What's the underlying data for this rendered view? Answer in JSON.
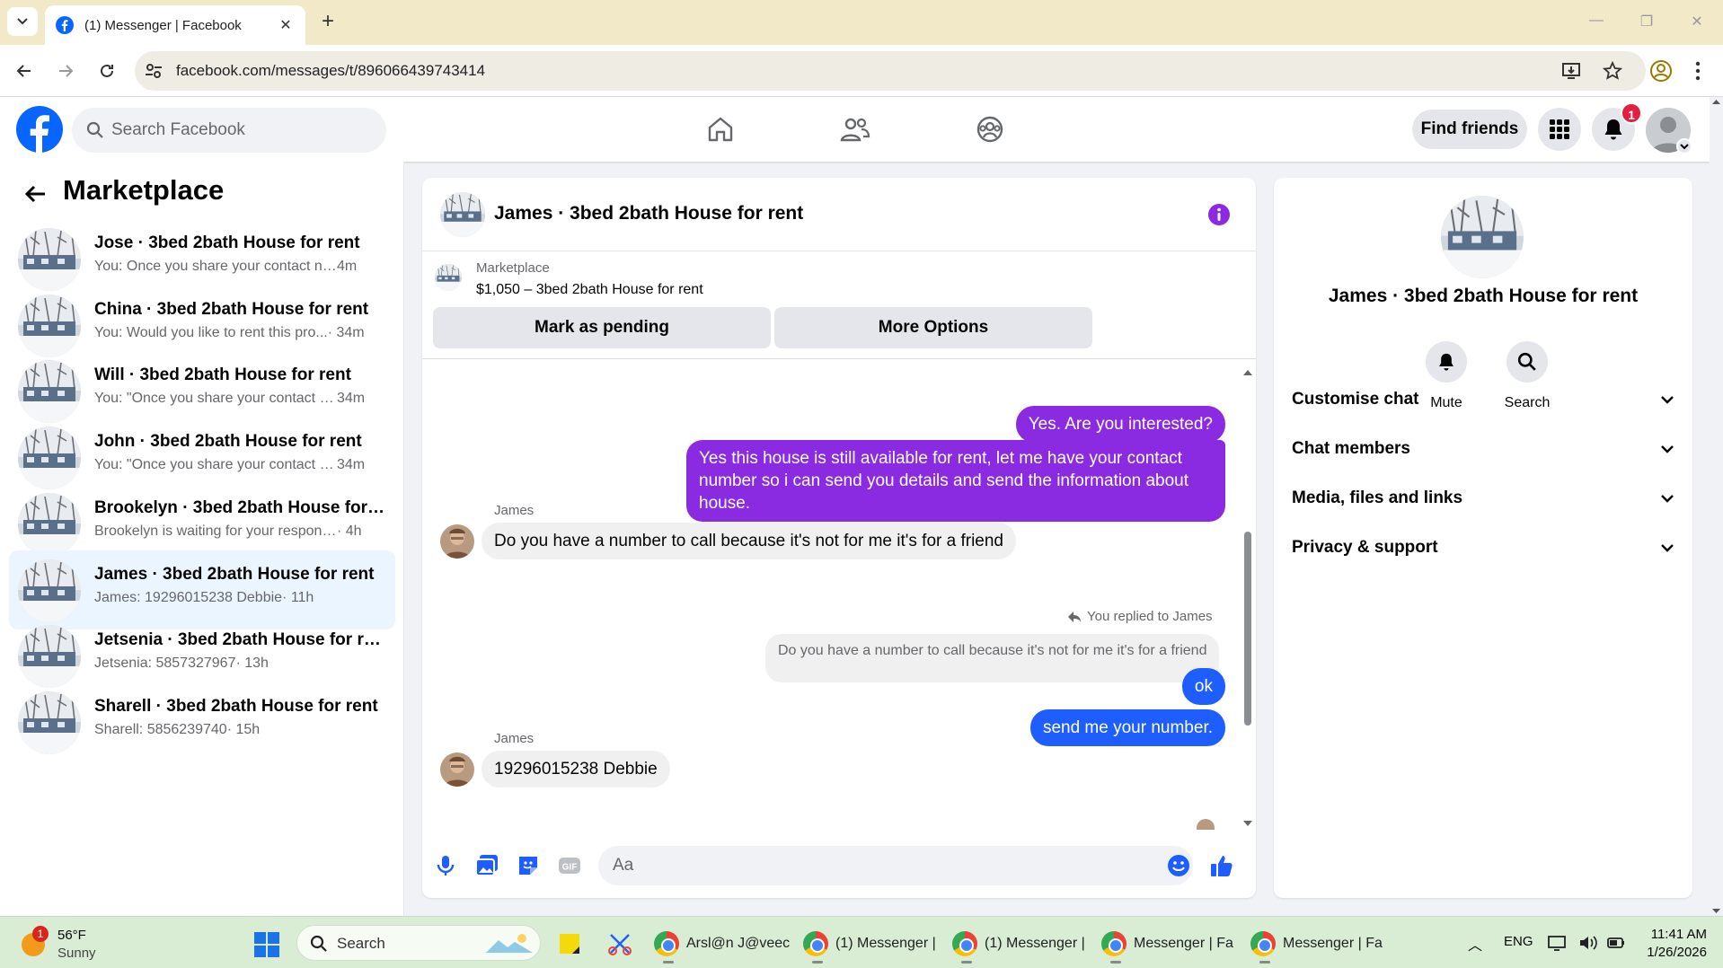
{
  "browser": {
    "tab_title": "(1) Messenger | Facebook",
    "url": "facebook.com/messages/t/896066439743414"
  },
  "header": {
    "search_placeholder": "Search Facebook",
    "find_friends": "Find friends",
    "notification_count": "1"
  },
  "sidebar": {
    "title": "Marketplace",
    "conversations": [
      {
        "name": "Jose · 3bed 2bath House for rent",
        "preview": "You: Once you share your contact nu...",
        "time": "4m",
        "active": false
      },
      {
        "name": "China · 3bed 2bath House for rent",
        "preview": "You: Would you like to rent this pro...",
        "time": "· 34m",
        "active": false
      },
      {
        "name": "Will · 3bed 2bath House for rent",
        "preview": "You: \"Once you share your contact n...",
        "time": "34m",
        "active": false
      },
      {
        "name": "John · 3bed 2bath House for rent",
        "preview": "You: \"Once you share your contact n...",
        "time": "34m",
        "active": false
      },
      {
        "name": "Brookelyn · 3bed 2bath House for rent",
        "preview": "Brookelyn is waiting for your response.",
        "time": "· 4h",
        "active": false
      },
      {
        "name": "James · 3bed 2bath House for rent",
        "preview": "James: 19296015238 Debbie",
        "time": "· 11h",
        "active": true
      },
      {
        "name": "Jetsenia · 3bed 2bath House for rent",
        "preview": "Jetsenia: 5857327967",
        "time": "· 13h",
        "active": false
      },
      {
        "name": "Sharell · 3bed 2bath House for rent",
        "preview": "Sharell: 5856239740",
        "time": "· 15h",
        "active": false
      }
    ]
  },
  "chat": {
    "title": "James · 3bed 2bath House for rent",
    "listing_source": "Marketplace",
    "listing_desc": "$1,050 – 3bed 2bath House for rent",
    "mark_pending": "Mark as pending",
    "more_options": "More Options",
    "messages": {
      "m1": "Yes. Are you interested?",
      "m2": "Yes this house is still available for rent, let me have your contact number so i can send you details and send the information about house.",
      "sender1": "James",
      "m3": "Do you have a number to call because it's not for me it's for a friend",
      "reply_note": "You replied to James",
      "quoted": "Do you have a number to call because it's not for me it's for a friend",
      "m4": "ok",
      "m5": "send me your number.",
      "sender2": "James",
      "m6": "19296015238 Debbie"
    },
    "composer_placeholder": "Aa"
  },
  "info_panel": {
    "name": "James · 3bed 2bath House for rent",
    "mute": "Mute",
    "search": "Search",
    "sections": [
      "Customise chat",
      "Chat members",
      "Media, files and links",
      "Privacy & support"
    ]
  },
  "taskbar": {
    "weather_badge": "1",
    "temp": "56°F",
    "condition": "Sunny",
    "search": "Search",
    "apps": [
      "Arsl@n J@veec",
      "(1) Messenger |",
      "(1) Messenger |",
      "Messenger | Fa",
      "Messenger | Fa"
    ],
    "lang": "ENG",
    "time": "11:41 AM",
    "date": "1/26/2026"
  },
  "colors": {
    "brand": "#0866ff",
    "outgoing_purple": "#8a2be2",
    "outgoing_blue": "#1e5eff",
    "active_conv": "#ebf5ff"
  }
}
